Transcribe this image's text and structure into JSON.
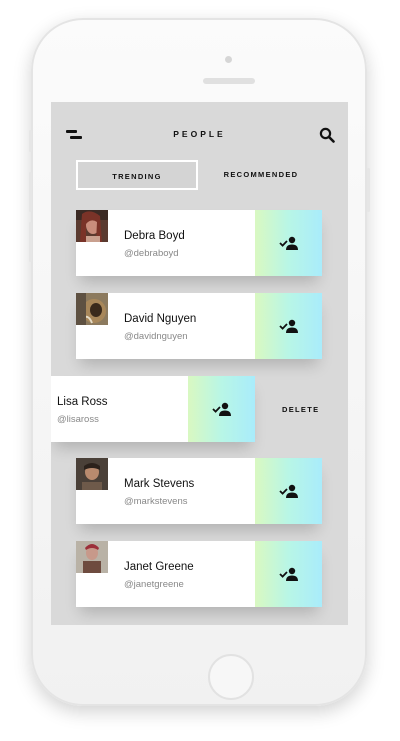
{
  "header": {
    "title": "PEOPLE"
  },
  "tabs": [
    {
      "label": "TRENDING",
      "selected": true
    },
    {
      "label": "RECOMMENDED",
      "selected": false
    }
  ],
  "people": [
    {
      "name": "Debra Boyd",
      "handle": "@debraboyd"
    },
    {
      "name": "David Nguyen",
      "handle": "@davidnguyen"
    },
    {
      "name": "Lisa Ross",
      "handle": "@lisaross"
    },
    {
      "name": "Mark Stevens",
      "handle": "@markstevens"
    },
    {
      "name": "Janet Greene",
      "handle": "@janetgreene"
    }
  ],
  "swipe_action": {
    "label": "DELETE"
  },
  "colors": {
    "screen_background": "#d9d9d9",
    "follow_gradient_start": "#d9f8c1",
    "follow_gradient_end": "#a9ecfb"
  },
  "icons": {
    "menu": "menu-icon",
    "search": "search-icon",
    "follow": "person-check-icon"
  }
}
